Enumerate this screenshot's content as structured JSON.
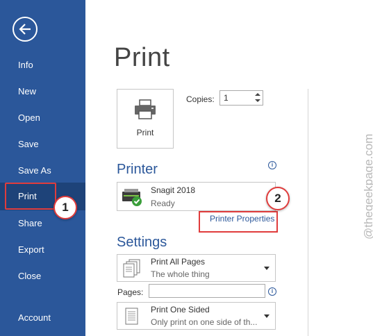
{
  "sidebar": {
    "items": [
      {
        "label": "Info"
      },
      {
        "label": "New"
      },
      {
        "label": "Open"
      },
      {
        "label": "Save"
      },
      {
        "label": "Save As"
      },
      {
        "label": "Print"
      },
      {
        "label": "Share"
      },
      {
        "label": "Export"
      },
      {
        "label": "Close"
      },
      {
        "label": "Account"
      }
    ],
    "accent": "#2b579a"
  },
  "annotations": {
    "step1": "1",
    "step2": "2",
    "highlight_color": "#e03c3c"
  },
  "main": {
    "title": "Print",
    "print_button_label": "Print",
    "copies_label": "Copies:",
    "copies_value": "1",
    "printer_heading": "Printer",
    "printer_name": "Snagit 2018",
    "printer_status": "Ready",
    "printer_properties_link": "Printer Properties",
    "settings_heading": "Settings",
    "print_range": {
      "title": "Print All Pages",
      "subtitle": "The whole thing"
    },
    "pages_label": "Pages:",
    "pages_value": "",
    "sides": {
      "title": "Print One Sided",
      "subtitle": "Only print on one side of th..."
    }
  },
  "watermark": "@thegeekpage.com"
}
